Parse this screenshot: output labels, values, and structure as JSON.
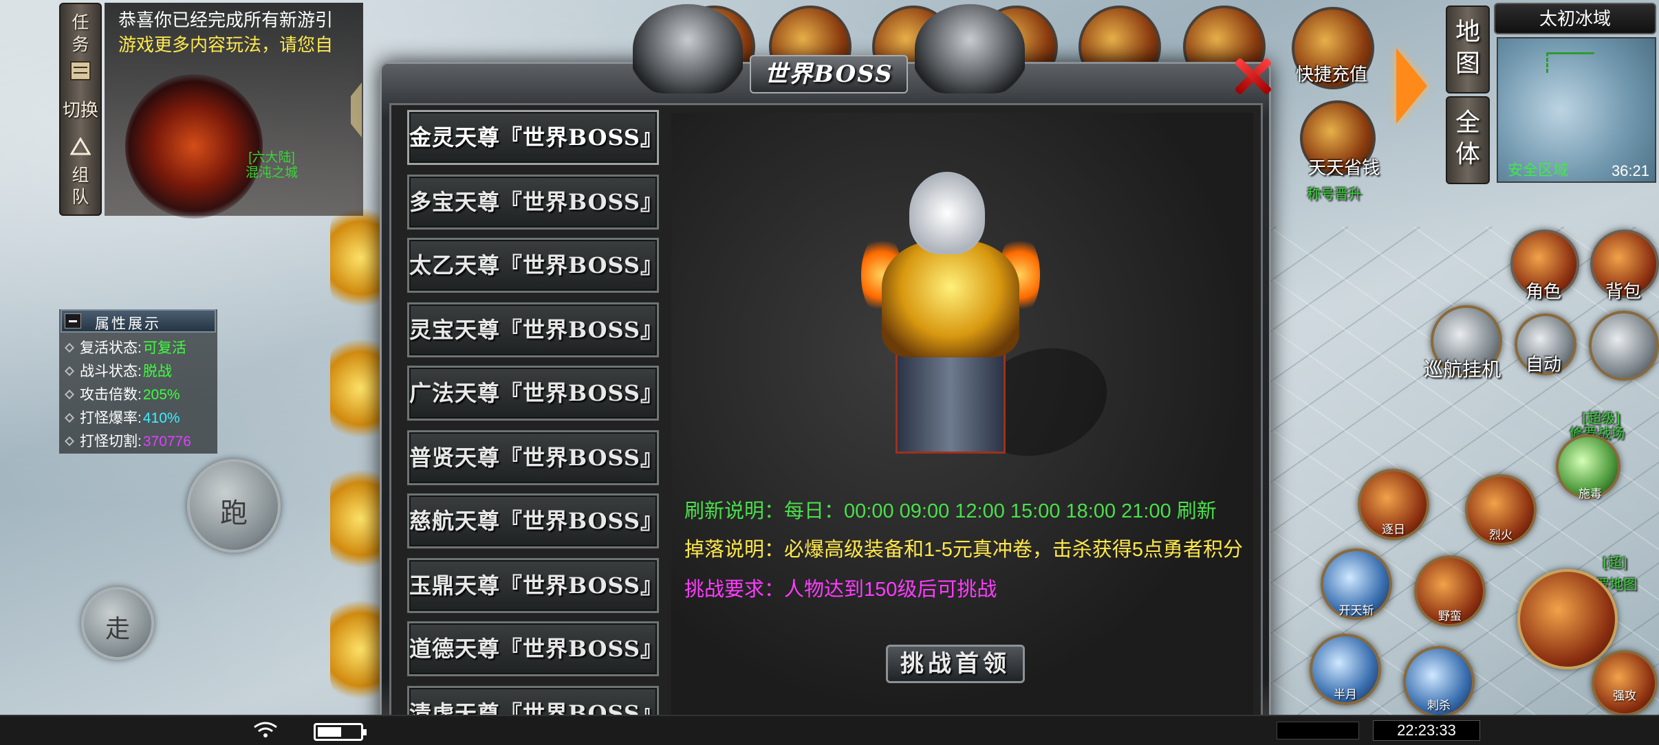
{
  "quest": {
    "tabs": [
      "任",
      "务",
      "切换",
      "组",
      "队"
    ],
    "line1": "恭喜你已经完成所有新游引",
    "line2": "游戏更多内容玩法，请您自",
    "portal_label1": "[六大陆]",
    "portal_label2": "混沌之城"
  },
  "attributes": {
    "title": "属性展示",
    "rows": [
      {
        "key": "复活状态:",
        "value": "可复活",
        "color": "#3cff3c"
      },
      {
        "key": "战斗状态:",
        "value": "脱战",
        "color": "#3cff3c"
      },
      {
        "key": "攻击倍数:",
        "value": "205%",
        "color": "#3cff3c"
      },
      {
        "key": "打怪爆率:",
        "value": "410%",
        "color": "#3cf0ff"
      },
      {
        "key": "打怪切割:",
        "value": "370776",
        "color": "#e040ff"
      }
    ]
  },
  "controls": {
    "run": "跑",
    "walk": "走"
  },
  "dialog": {
    "title": "世界BOSS",
    "bosses": [
      "金灵天尊『世界BOSS』",
      "多宝天尊『世界BOSS』",
      "太乙天尊『世界BOSS』",
      "灵宝天尊『世界BOSS』",
      "广法天尊『世界BOSS』",
      "普贤天尊『世界BOSS』",
      "慈航天尊『世界BOSS』",
      "玉鼎天尊『世界BOSS』",
      "道德天尊『世界BOSS』",
      "清虚天尊『世界BOSS』"
    ],
    "refresh": "刷新说明：每日：00:00  09:00 12:00 15:00 18:00 21:00 刷新",
    "drop": "掉落说明：必爆高级装备和1-5元真冲卷，击杀获得5点勇者积分",
    "requirement": "挑战要求：人物达到150级后可挑战",
    "challenge_button": "挑战首领"
  },
  "top_right": {
    "recharge": "快捷充值",
    "save_money": "天天省钱",
    "title_promo": "称号晋升",
    "map_btn": "地图",
    "full_btn": "全体",
    "zone_name": "太初冰域",
    "safe_zone": "安全区域",
    "map_time": "36:21"
  },
  "right_menu": {
    "role": "角色",
    "bag": "背包",
    "auto": "自动",
    "patrol": "巡航挂机"
  },
  "skills": {
    "s1": "逐日",
    "s2": "烈火",
    "s3": "开天斩",
    "s4": "野蛮",
    "s5": "半月",
    "s6": "刺杀",
    "s7": "强攻",
    "s8": "施毒",
    "side1": "[超级]",
    "side2": "修罗战场",
    "side3": "[超]",
    "side4": "罗地图"
  },
  "status_bar": {
    "clock": "22:23:33"
  }
}
